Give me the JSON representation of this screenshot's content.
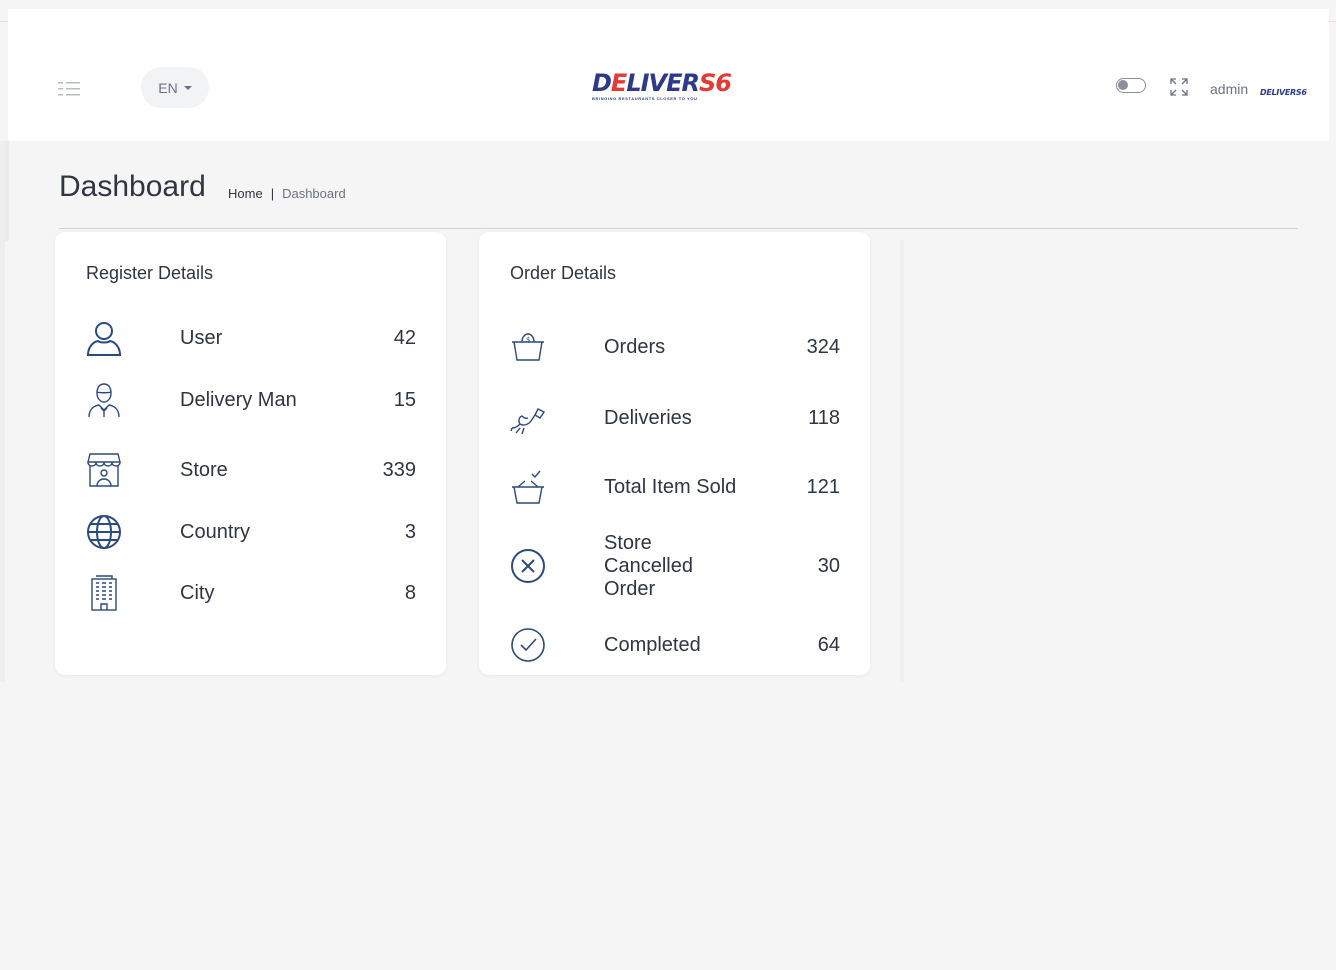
{
  "header": {
    "language": "EN",
    "logo": {
      "word_d": "D",
      "word_e": "E",
      "word_rest": "LIVER",
      "word_nums": "S6",
      "tagline": "BRINGING RESTAURANTS CLOSER TO YOU"
    },
    "user_name": "admin",
    "avatar_word": "DELIVERS6"
  },
  "page": {
    "title": "Dashboard",
    "breadcrumb": {
      "home": "Home",
      "separator": "|",
      "current": "Dashboard"
    }
  },
  "register": {
    "title": "Register Details",
    "items": [
      {
        "label": "User",
        "value": "42",
        "icon": "user-icon"
      },
      {
        "label": "Delivery Man",
        "value": "15",
        "icon": "delivery-man-icon"
      },
      {
        "label": "Store",
        "value": "339",
        "icon": "store-icon"
      },
      {
        "label": "Country",
        "value": "3",
        "icon": "globe-icon"
      },
      {
        "label": "City",
        "value": "8",
        "icon": "building-icon"
      }
    ]
  },
  "orders": {
    "title": "Order Details",
    "items": [
      {
        "label": "Orders",
        "value": "324",
        "icon": "basket-icon"
      },
      {
        "label": "Deliveries",
        "value": "118",
        "icon": "delivery-bird-icon"
      },
      {
        "label": "Total Item Sold",
        "value": "121",
        "icon": "basket-check-icon"
      },
      {
        "label": "Store Cancelled Order",
        "value": "30",
        "icon": "cancel-circle-icon"
      },
      {
        "label": "Completed",
        "value": "64",
        "icon": "check-circle-icon"
      }
    ]
  },
  "colors": {
    "icon_blue": "#2c4a7c",
    "logo_blue": "#2d3a8c",
    "logo_red": "#e53935"
  }
}
